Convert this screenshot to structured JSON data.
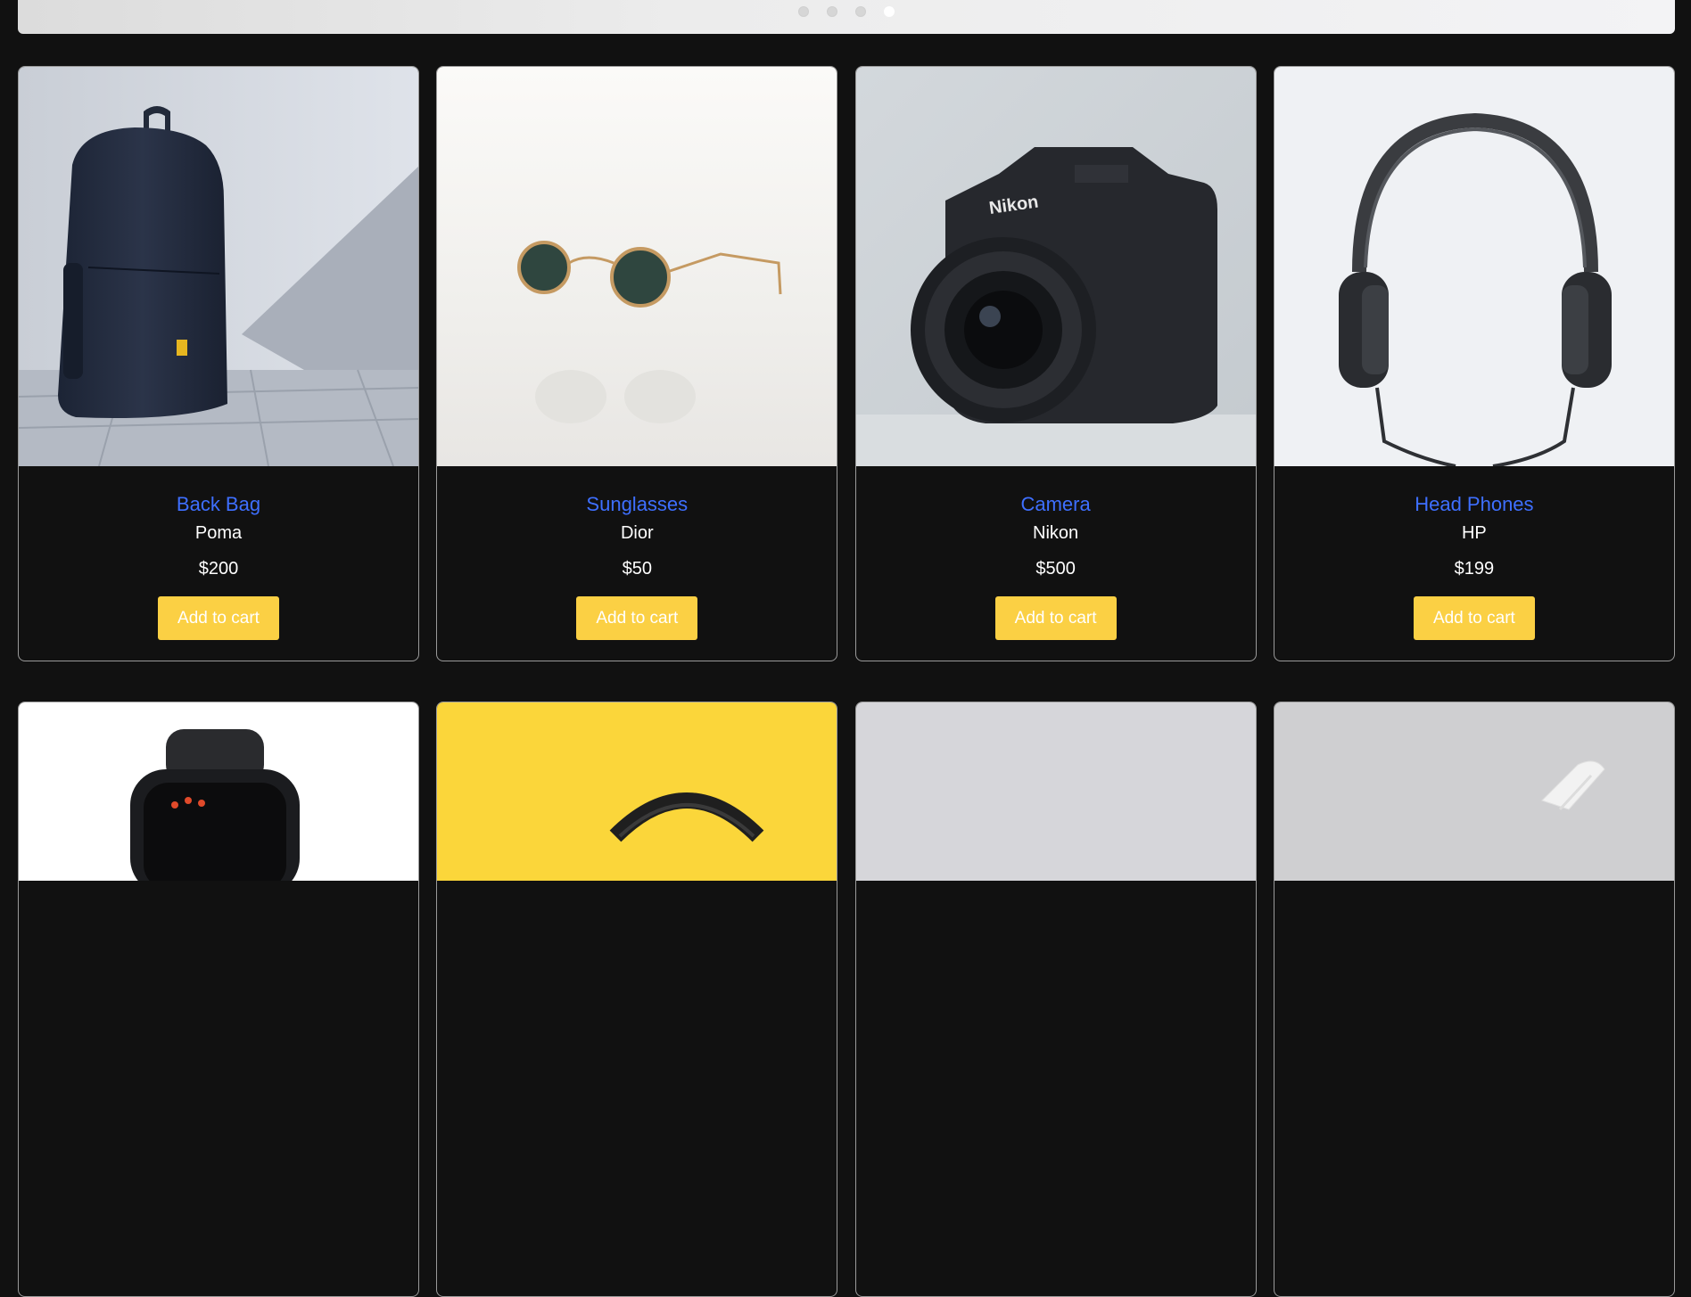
{
  "carousel": {
    "slides": 4,
    "active_index": 3
  },
  "products": [
    {
      "name": "Back Bag",
      "brand": "Poma",
      "price": "$200",
      "cta": "Add to cart",
      "image": "backpack-image"
    },
    {
      "name": "Sunglasses",
      "brand": "Dior",
      "price": "$50",
      "cta": "Add to cart",
      "image": "sunglasses-image"
    },
    {
      "name": "Camera",
      "brand": "Nikon",
      "price": "$500",
      "cta": "Add to cart",
      "image": "camera-image"
    },
    {
      "name": "Head Phones",
      "brand": "HP",
      "price": "$199",
      "cta": "Add to cart",
      "image": "headphones-image"
    }
  ],
  "products_row2": [
    {
      "image": "smartwatch-image"
    },
    {
      "image": "yellow-headphones-image"
    },
    {
      "image": "grey-product-image"
    },
    {
      "image": "white-strap-image"
    }
  ],
  "colors": {
    "background": "#111111",
    "name_link": "#3e6fff",
    "button": "#fbd044",
    "text": "#ffffff"
  },
  "camera_brand_mark": "Nikon"
}
